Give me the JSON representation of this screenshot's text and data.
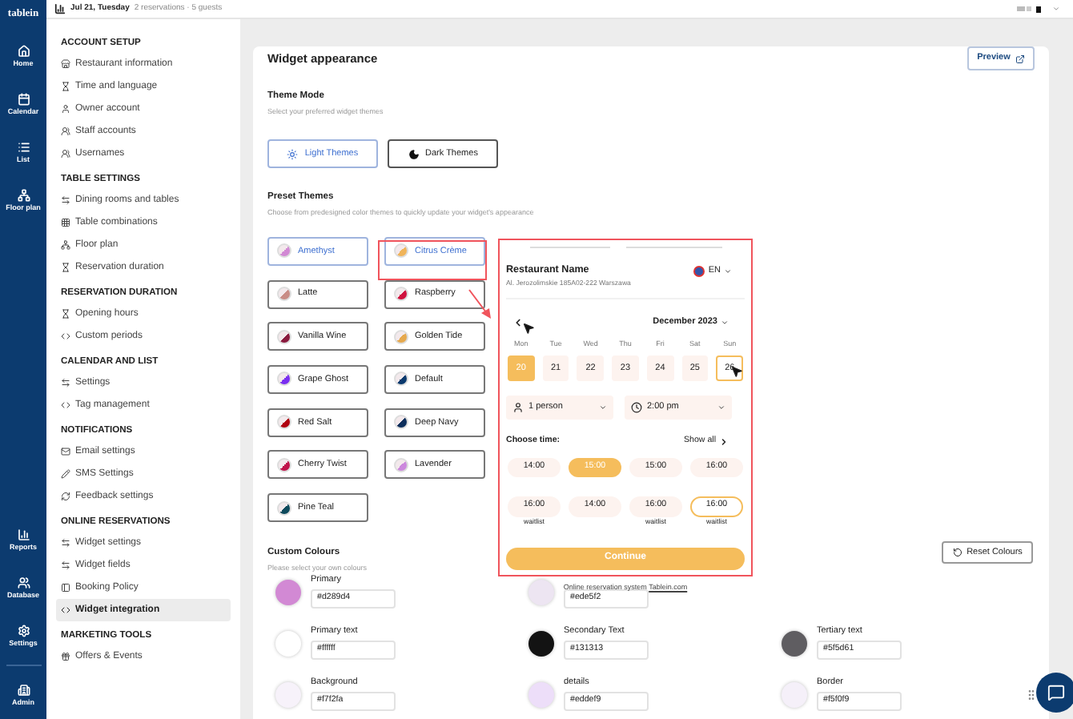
{
  "rail": {
    "logo": "tablein",
    "top_items": [
      {
        "label": "Home",
        "selected": false
      },
      {
        "label": "Calendar",
        "selected": false
      },
      {
        "label": "List",
        "selected": false
      },
      {
        "label": "Floor plan",
        "selected": false
      }
    ],
    "bottom_items": [
      {
        "label": "Reports",
        "selected": false
      },
      {
        "label": "Database",
        "selected": false
      },
      {
        "label": "Settings",
        "selected": false
      }
    ],
    "account_item": {
      "label": "Admin"
    }
  },
  "top_bar": {
    "date": "Jul 21, Tuesday",
    "summary": "2 reservations · 5 guests"
  },
  "sidebar": {
    "sections": [
      {
        "title": "ACCOUNT SETUP",
        "items": [
          {
            "label": "Restaurant information",
            "selected": false
          },
          {
            "label": "Time and language",
            "selected": false
          },
          {
            "label": "Owner account",
            "selected": false
          },
          {
            "label": "Staff accounts",
            "selected": false
          },
          {
            "label": "Usernames",
            "selected": false
          }
        ]
      },
      {
        "title": "TABLE SETTINGS",
        "items": [
          {
            "label": "Dining rooms and tables",
            "selected": false
          },
          {
            "label": "Table combinations",
            "selected": false
          },
          {
            "label": "Floor plan",
            "selected": false
          },
          {
            "label": "Reservation duration",
            "selected": false
          }
        ]
      },
      {
        "title": "RESERVATION DURATION",
        "items": [
          {
            "label": "Opening hours",
            "selected": false
          },
          {
            "label": "Custom periods",
            "selected": false
          }
        ]
      },
      {
        "title": "CALENDAR AND LIST",
        "items": [
          {
            "label": "Settings",
            "selected": false
          },
          {
            "label": "Tag management",
            "selected": false
          }
        ]
      },
      {
        "title": "NOTIFICATIONS",
        "items": [
          {
            "label": "Email settings",
            "selected": false
          },
          {
            "label": "SMS Settings",
            "selected": false
          },
          {
            "label": "Feedback settings",
            "selected": false
          }
        ]
      },
      {
        "title": "ONLINE RESERVATIONS",
        "items": [
          {
            "label": "Widget settings",
            "selected": false
          },
          {
            "label": "Widget fields",
            "selected": false
          },
          {
            "label": "Booking Policy",
            "selected": false
          },
          {
            "label": "Widget integration",
            "selected": true
          }
        ]
      },
      {
        "title": "MARKETING TOOLS",
        "items": [
          {
            "label": "Offers & Events",
            "selected": false
          }
        ]
      }
    ]
  },
  "page": {
    "title": "Widget appearance",
    "preview_button": "Preview",
    "theme_mode": {
      "title": "Theme Mode",
      "subtitle": "Select your preferred widget themes",
      "options": [
        {
          "label": "Light Themes",
          "kind": "light",
          "selected": true
        },
        {
          "label": "Dark Themes",
          "kind": "dark",
          "selected": false
        }
      ]
    },
    "preset_themes": {
      "title": "Preset Themes",
      "subtitle": "Choose from predesigned color themes to quickly update your widget's appearance",
      "themes": [
        {
          "label": "Amethyst",
          "color": "#d289d4",
          "selected": true
        },
        {
          "label": "Citrus Crème",
          "color": "#f0b45a",
          "selected": true
        },
        {
          "label": "Latte",
          "color": "#c98c86",
          "selected": false
        },
        {
          "label": "Raspberry",
          "color": "#d0123f",
          "selected": false
        },
        {
          "label": "Vanilla Wine",
          "color": "#8a1a3e",
          "selected": false
        },
        {
          "label": "Golden Tide",
          "color": "#e6a94e",
          "selected": false
        },
        {
          "label": "Grape Ghost",
          "color": "#7a2ff0",
          "selected": false
        },
        {
          "label": "Default",
          "color": "#0b3a6e",
          "selected": false
        },
        {
          "label": "Red Salt",
          "color": "#b00010",
          "selected": false
        },
        {
          "label": "Deep Navy",
          "color": "#0d2f5c",
          "selected": false
        },
        {
          "label": "Cherry Twist",
          "color": "#c0124a",
          "selected": false
        },
        {
          "label": "Lavender",
          "color": "#cc88dd",
          "selected": false
        },
        {
          "label": "Pine Teal",
          "color": "#0d4a5c",
          "selected": false
        }
      ]
    },
    "custom_colours": {
      "title": "Custom Colours",
      "subtitle": "Please select your own colours",
      "reset_button": "Reset Colours",
      "rows": [
        [
          {
            "label": "Primary",
            "value": "#d289d4",
            "color": "#d289d4"
          },
          {
            "value": "#ede5f2",
            "color": "#ede5f2"
          }
        ],
        [
          {
            "label": "Primary text",
            "value": "#ffffff",
            "color": "#ffffff"
          },
          {
            "label": "Secondary Text",
            "value": "#131313",
            "color": "#131313"
          },
          {
            "label": "Tertiary text",
            "value": "#5f5d61",
            "color": "#5f5d61"
          }
        ],
        [
          {
            "label": "Background",
            "value": "#f7f2fa",
            "color": "#f7f2fa"
          },
          {
            "label": "details",
            "value": "#eddef9",
            "color": "#eddef9"
          },
          {
            "label": "Border",
            "value": "#f5f0f9",
            "color": "#f5f0f9"
          }
        ]
      ]
    }
  },
  "widget": {
    "restaurant_name": "Restaurant Name",
    "address": "Al. Jerozolimskie 185A02-222 Warszawa",
    "language": "EN",
    "month": "December 2023",
    "days": [
      {
        "weekday": "Mon",
        "date": "20",
        "selected": true,
        "highlighted": false
      },
      {
        "weekday": "Tue",
        "date": "21",
        "selected": false,
        "highlighted": false
      },
      {
        "weekday": "Wed",
        "date": "22",
        "selected": false,
        "highlighted": false
      },
      {
        "weekday": "Thu",
        "date": "23",
        "selected": false,
        "highlighted": false
      },
      {
        "weekday": "Fri",
        "date": "24",
        "selected": false,
        "highlighted": false
      },
      {
        "weekday": "Sat",
        "date": "25",
        "selected": false,
        "highlighted": false
      },
      {
        "weekday": "Sun",
        "date": "26",
        "selected": false,
        "highlighted": true
      }
    ],
    "guests": "1 person",
    "time": "2:00 pm",
    "choose_time": "Choose time:",
    "show_all": "Show all",
    "slots": [
      {
        "time": "14:00",
        "selected": false,
        "highlighted": false
      },
      {
        "time": "15:00",
        "selected": true,
        "highlighted": false
      },
      {
        "time": "15:00",
        "selected": false,
        "highlighted": false
      },
      {
        "time": "16:00",
        "selected": false,
        "highlighted": false
      },
      {
        "time": "16:00",
        "note": "waitlist",
        "selected": false,
        "highlighted": false
      },
      {
        "time": "14:00",
        "selected": false,
        "highlighted": false
      },
      {
        "time": "16:00",
        "note": "waitlist",
        "selected": false,
        "highlighted": false
      },
      {
        "time": "16:00",
        "note": "waitlist",
        "selected": false,
        "highlighted": true
      }
    ],
    "continue_button": "Continue",
    "caption": "Online reservation system",
    "caption_link": "Tablein.com"
  }
}
